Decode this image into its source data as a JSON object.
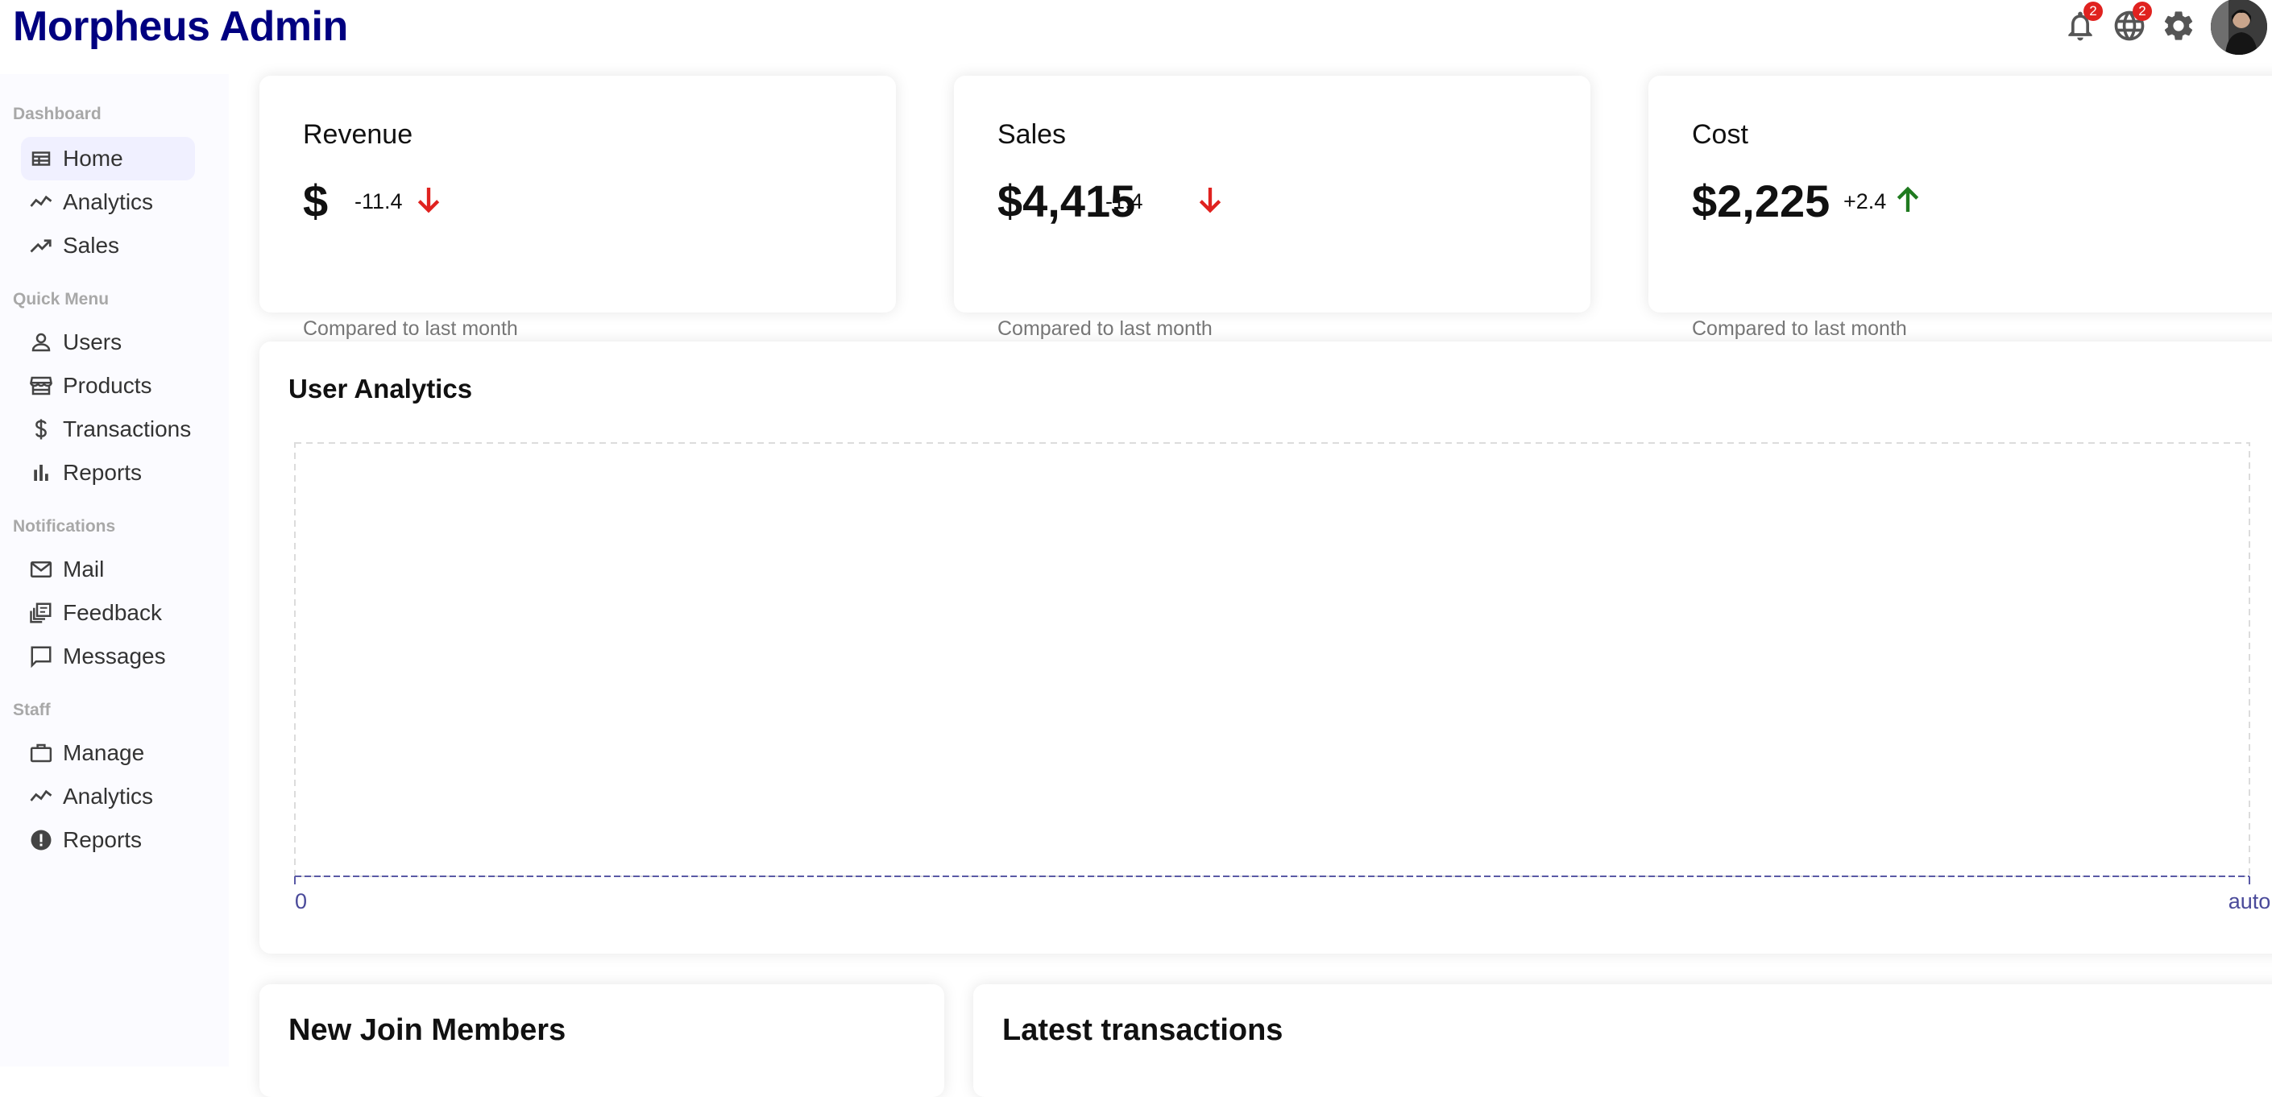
{
  "header": {
    "logo": "Morpheus Admin",
    "notification_count": "2",
    "language_count": "2"
  },
  "icons": {
    "top": [
      "bell-icon",
      "language-icon",
      "settings-icon",
      "user-avatar"
    ],
    "nav": [
      "table-icon",
      "timeline-icon",
      "trending-up-icon",
      "person-icon",
      "storefront-icon",
      "dollar-icon",
      "bar-chart-icon",
      "mail-icon",
      "feedback-icon",
      "message-icon",
      "work-icon",
      "timeline-icon",
      "report-icon"
    ]
  },
  "sidebar": {
    "sections": [
      {
        "title": "Dashboard",
        "items": [
          {
            "label": "Home",
            "active": true
          },
          {
            "label": "Analytics"
          },
          {
            "label": "Sales"
          }
        ]
      },
      {
        "title": "Quick Menu",
        "items": [
          {
            "label": "Users"
          },
          {
            "label": "Products"
          },
          {
            "label": "Transactions"
          },
          {
            "label": "Reports"
          }
        ]
      },
      {
        "title": "Notifications",
        "items": [
          {
            "label": "Mail"
          },
          {
            "label": "Feedback"
          },
          {
            "label": "Messages"
          }
        ]
      },
      {
        "title": "Staff",
        "items": [
          {
            "label": "Manage"
          },
          {
            "label": "Analytics"
          },
          {
            "label": "Reports"
          }
        ]
      }
    ]
  },
  "featured": [
    {
      "title": "Revenue",
      "money": "$",
      "rate": "-11.4",
      "trend": "down",
      "sub": "Compared to last month"
    },
    {
      "title": "Sales",
      "money": "$4,415",
      "rate": "-1.4",
      "trend": "down",
      "sub": "Compared to last month"
    },
    {
      "title": "Cost",
      "money": "$2,225",
      "rate": "+2.4",
      "trend": "up",
      "sub": "Compared to last month"
    }
  ],
  "colors": {
    "brand": "#000080",
    "trend_down": "#e0221f",
    "trend_up": "#1f7a1f",
    "axis": "#5a5aa6"
  },
  "chart": {
    "title": "User Analytics",
    "x_ticks": [
      "0",
      "auto"
    ]
  },
  "chart_data": {
    "type": "line",
    "title": "User Analytics",
    "x": [
      "0",
      "auto"
    ],
    "series": [],
    "grid": true
  },
  "bottom": {
    "members_title": "New Join Members",
    "transactions_title": "Latest transactions"
  }
}
